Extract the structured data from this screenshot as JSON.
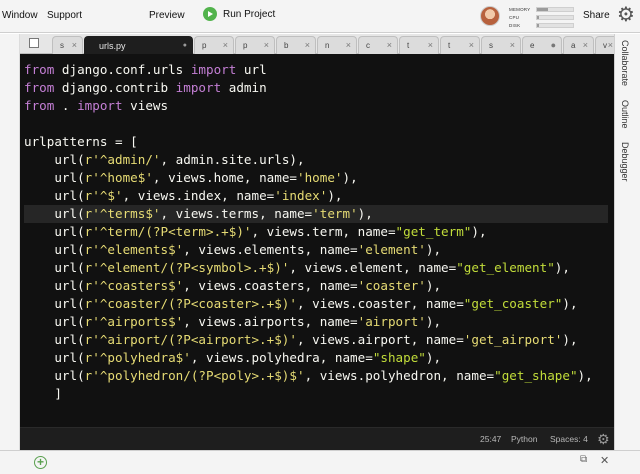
{
  "menubar": {
    "items": [
      "Window",
      "Support"
    ],
    "preview": "Preview",
    "run": "Run Project",
    "stats": [
      {
        "label": "MEMORY",
        "fill": 0.3
      },
      {
        "label": "CPU",
        "fill": 0.05
      },
      {
        "label": "DISK",
        "fill": 0.05
      }
    ],
    "share": "Share"
  },
  "tabs": [
    {
      "label": "s",
      "close": "×"
    },
    {
      "label": "urls.py",
      "close": "●",
      "active": true
    },
    {
      "label": "p",
      "close": "×"
    },
    {
      "label": "p",
      "close": "×"
    },
    {
      "label": "b",
      "close": "×"
    },
    {
      "label": "n",
      "close": "×"
    },
    {
      "label": "c",
      "close": "×"
    },
    {
      "label": "t",
      "close": "×"
    },
    {
      "label": "t",
      "close": "×"
    },
    {
      "label": "s",
      "close": "×"
    },
    {
      "label": "e",
      "close": "●"
    },
    {
      "label": "a",
      "close": "×"
    },
    {
      "label": "v",
      "close": "×"
    }
  ],
  "code_lines": [
    [
      [
        "kw",
        "from"
      ],
      [
        "p",
        " django.conf.urls "
      ],
      [
        "kw",
        "import"
      ],
      [
        "p",
        " url"
      ]
    ],
    [
      [
        "kw",
        "from"
      ],
      [
        "p",
        " django.contrib "
      ],
      [
        "kw",
        "import"
      ],
      [
        "p",
        " admin"
      ]
    ],
    [
      [
        "kw",
        "from"
      ],
      [
        "p",
        " . "
      ],
      [
        "kw",
        "import"
      ],
      [
        "p",
        " views"
      ]
    ],
    [],
    [
      [
        "p",
        "urlpatterns = ["
      ]
    ],
    [
      [
        "p",
        "    url("
      ],
      [
        "s1",
        "r'^admin/'"
      ],
      [
        "p",
        ", admin.site.urls),"
      ]
    ],
    [
      [
        "p",
        "    url("
      ],
      [
        "s1",
        "r'^home$'"
      ],
      [
        "p",
        ", views.home, name="
      ],
      [
        "s1",
        "'home'"
      ],
      [
        "p",
        "),"
      ]
    ],
    [
      [
        "p",
        "    url("
      ],
      [
        "s1",
        "r'^$'"
      ],
      [
        "p",
        ", views.index, name="
      ],
      [
        "s1",
        "'index'"
      ],
      [
        "p",
        "),"
      ]
    ],
    [
      [
        "p",
        "    url("
      ],
      [
        "s1",
        "r'^terms$'"
      ],
      [
        "p",
        ", views.terms, name="
      ],
      [
        "s1",
        "'term'"
      ],
      [
        "p",
        "),"
      ]
    ],
    [
      [
        "p",
        "    url("
      ],
      [
        "s1",
        "r'^term/(?P<term>.+$)'"
      ],
      [
        "p",
        ", views.term, name="
      ],
      [
        "s2",
        "\"get_term\""
      ],
      [
        "p",
        "),"
      ]
    ],
    [
      [
        "p",
        "    url("
      ],
      [
        "s1",
        "r'^elements$'"
      ],
      [
        "p",
        ", views.elements, name="
      ],
      [
        "s1",
        "'element'"
      ],
      [
        "p",
        "),"
      ]
    ],
    [
      [
        "p",
        "    url("
      ],
      [
        "s1",
        "r'^element/(?P<symbol>.+$)'"
      ],
      [
        "p",
        ", views.element, name="
      ],
      [
        "s2",
        "\"get_element\""
      ],
      [
        "p",
        "),"
      ]
    ],
    [
      [
        "p",
        "    url("
      ],
      [
        "s1",
        "r'^coasters$'"
      ],
      [
        "p",
        ", views.coasters, name="
      ],
      [
        "s1",
        "'coaster'"
      ],
      [
        "p",
        "),"
      ]
    ],
    [
      [
        "p",
        "    url("
      ],
      [
        "s1",
        "r'^coaster/(?P<coaster>.+$)'"
      ],
      [
        "p",
        ", views.coaster, name="
      ],
      [
        "s2",
        "\"get_coaster\""
      ],
      [
        "p",
        "),"
      ]
    ],
    [
      [
        "p",
        "    url("
      ],
      [
        "s1",
        "r'^airports$'"
      ],
      [
        "p",
        ", views.airports, name="
      ],
      [
        "s1",
        "'airport'"
      ],
      [
        "p",
        "),"
      ]
    ],
    [
      [
        "p",
        "    url("
      ],
      [
        "s1",
        "r'^airport/(?P<airport>.+$)'"
      ],
      [
        "p",
        ", views.airport, name="
      ],
      [
        "s1",
        "'get_airport'"
      ],
      [
        "p",
        "),"
      ]
    ],
    [
      [
        "p",
        "    url("
      ],
      [
        "s1",
        "r'^polyhedra$'"
      ],
      [
        "p",
        ", views.polyhedra, name="
      ],
      [
        "s2",
        "\"shape\""
      ],
      [
        "p",
        "),"
      ]
    ],
    [
      [
        "p",
        "    url("
      ],
      [
        "s1",
        "r'^polyhedron/(?P<poly>.+$)$'"
      ],
      [
        "p",
        ", views.polyhedron, name="
      ],
      [
        "s2",
        "\"get_shape\""
      ],
      [
        "p",
        "),"
      ]
    ],
    [
      [
        "p",
        "    ]"
      ]
    ]
  ],
  "current_line": 8,
  "status": {
    "position": "25:47",
    "language": "Python",
    "spaces": "Spaces: 4"
  },
  "side_tabs": [
    "Collaborate",
    "Outline",
    "Debugger"
  ],
  "colors": {
    "run": "#52b34c",
    "keyword": "#c47fd5",
    "string": "#e6db74",
    "string_double": "#c2dd3a",
    "editor_bg": "#111111"
  }
}
